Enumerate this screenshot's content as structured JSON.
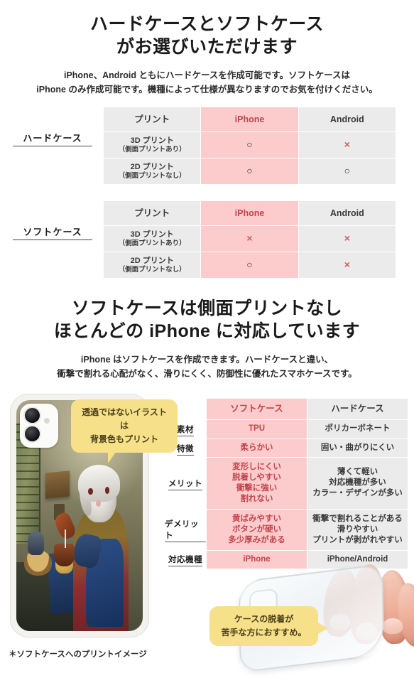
{
  "section1": {
    "heading_line1": "ハードケースとソフトケース",
    "heading_line2": "がお選びいただけます",
    "lead_line1": "iPhone、Android ともにハードケースを作成可能です。ソフトケースは",
    "lead_line2": "iPhone のみ作成可能です。機種によって仕様が異なりますのでお気を付けください。",
    "tables": [
      {
        "row_label": "ハードケース",
        "headers": [
          "プリント",
          "iPhone",
          "Android"
        ],
        "rows": [
          {
            "print_name": "3D プリント",
            "print_note": "（側面プリントあり）",
            "iphone": "○",
            "android": "×"
          },
          {
            "print_name": "2D プリント",
            "print_note": "（側面プリントなし）",
            "iphone": "○",
            "android": "○"
          }
        ]
      },
      {
        "row_label": "ソフトケース",
        "headers": [
          "プリント",
          "iPhone",
          "Android"
        ],
        "rows": [
          {
            "print_name": "3D プリント",
            "print_note": "（側面プリントあり）",
            "iphone": "×",
            "android": "×"
          },
          {
            "print_name": "2D プリント",
            "print_note": "（側面プリントなし）",
            "iphone": "○",
            "android": "×"
          }
        ]
      }
    ]
  },
  "section2": {
    "heading_line1": "ソフトケースは側面プリントなし",
    "heading_line2": "ほとんどの iPhone に対応しています",
    "lead_line1": "iPhone はソフトケースを作成できます。ハードケースと違い、",
    "lead_line2": "衝撃で割れる心配がなく、滑りにくく、防御性に優れたスマホケースです。"
  },
  "spec_table": {
    "col_headers": [
      "ソフトケース",
      "ハードケース"
    ],
    "rows": [
      {
        "label": "素材",
        "soft": "TPU",
        "hard": "ポリカーボネート"
      },
      {
        "label": "特徴",
        "soft": "柔らかい",
        "hard": "固い・曲がりにくい"
      },
      {
        "label": "メリット",
        "soft": "変形しにくい\n脱着しやすい\n衝撃に強い\n割れない",
        "hard": "薄くて軽い\n対応機種が多い\nカラー・デザインが多い"
      },
      {
        "label": "デメリット",
        "soft": "黄ばみやすい\nボタンが硬い\n多少厚みがある",
        "hard": "衝撃で割れることがある\n滑りやすい\nプリントが剥がれやすい"
      },
      {
        "label": "対応機種",
        "soft": "iPhone",
        "hard": "iPhone/Android"
      }
    ]
  },
  "bubbles": {
    "print_bubble_line1": "透過ではないイラストは",
    "print_bubble_line2": "背景色もプリント",
    "easy_bubble_line1": "ケースの脱着が",
    "easy_bubble_line2": "苦手な方におすすめ。"
  },
  "footnote": "＊ソフトケースへのプリントイメージ",
  "colors": {
    "pink_fill": "#fccbcb",
    "pink_text": "#c1464d",
    "gray_fill": "#ebebeb",
    "bubble_yellow": "#f6e08a",
    "body_text": "#2b2b2b"
  }
}
